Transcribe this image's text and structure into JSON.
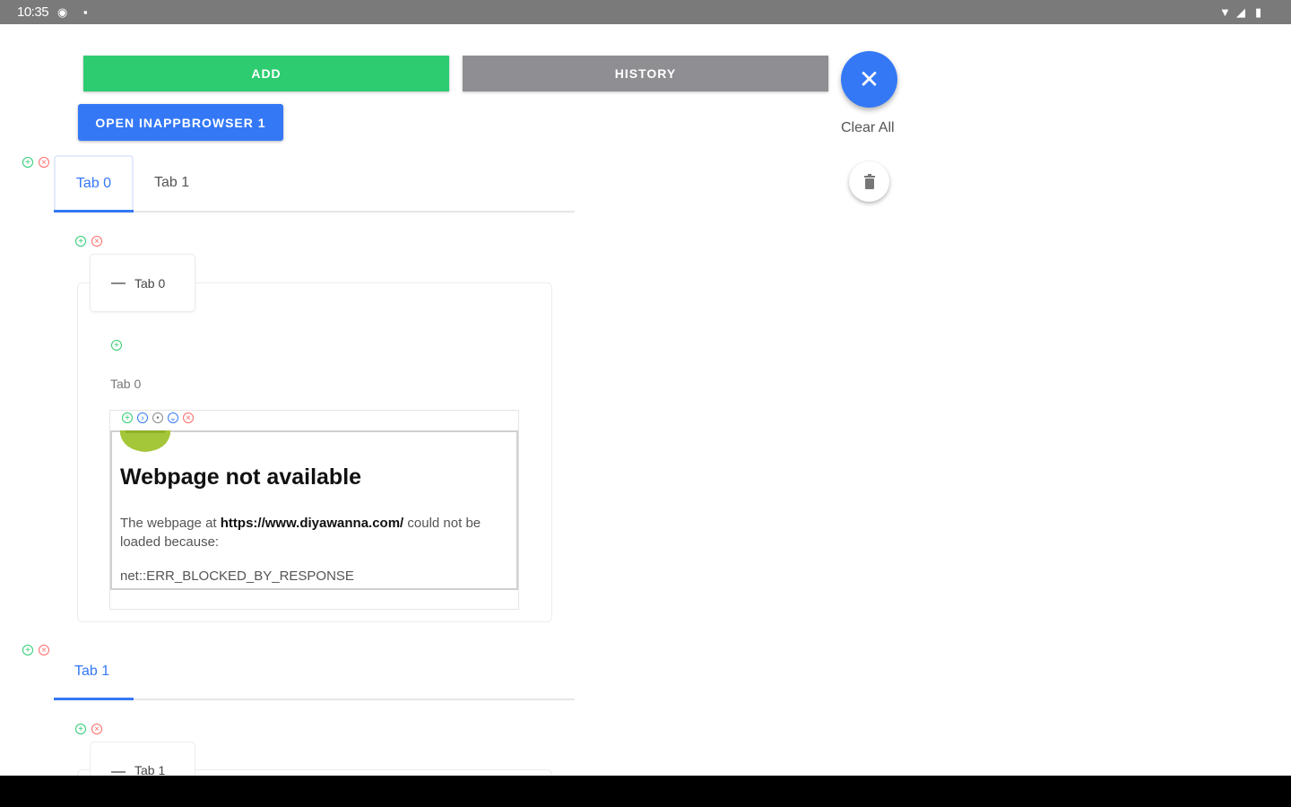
{
  "status_bar": {
    "time": "10:35",
    "icons": [
      "location-icon",
      "notification-icon",
      "wifi-icon",
      "signal-icon",
      "battery-icon"
    ]
  },
  "toolbar": {
    "add_label": "ADD",
    "history_label": "HISTORY",
    "open_iab_label": "OPEN INAPPBROWSER 1",
    "clear_all_label": "Clear All"
  },
  "tabs": [
    {
      "label": "Tab 0",
      "selected": true
    },
    {
      "label": "Tab 1",
      "selected": false
    }
  ],
  "accordion": {
    "header": "Tab 0",
    "panel_label": "Tab 0"
  },
  "webview": {
    "title": "Webpage not available",
    "message_prefix": "The webpage at ",
    "url": "https://www.diyawanna.com/",
    "message_suffix": " could not be loaded because:",
    "error_code": "net::ERR_BLOCKED_BY_RESPONSE"
  },
  "second_section": {
    "tab_label": "Tab 1",
    "accordion_header": "Tab 1"
  },
  "colors": {
    "add": "#2ecc71",
    "history": "#8e8e93",
    "accent": "#3478f6",
    "danger": "#ff6b6b"
  }
}
